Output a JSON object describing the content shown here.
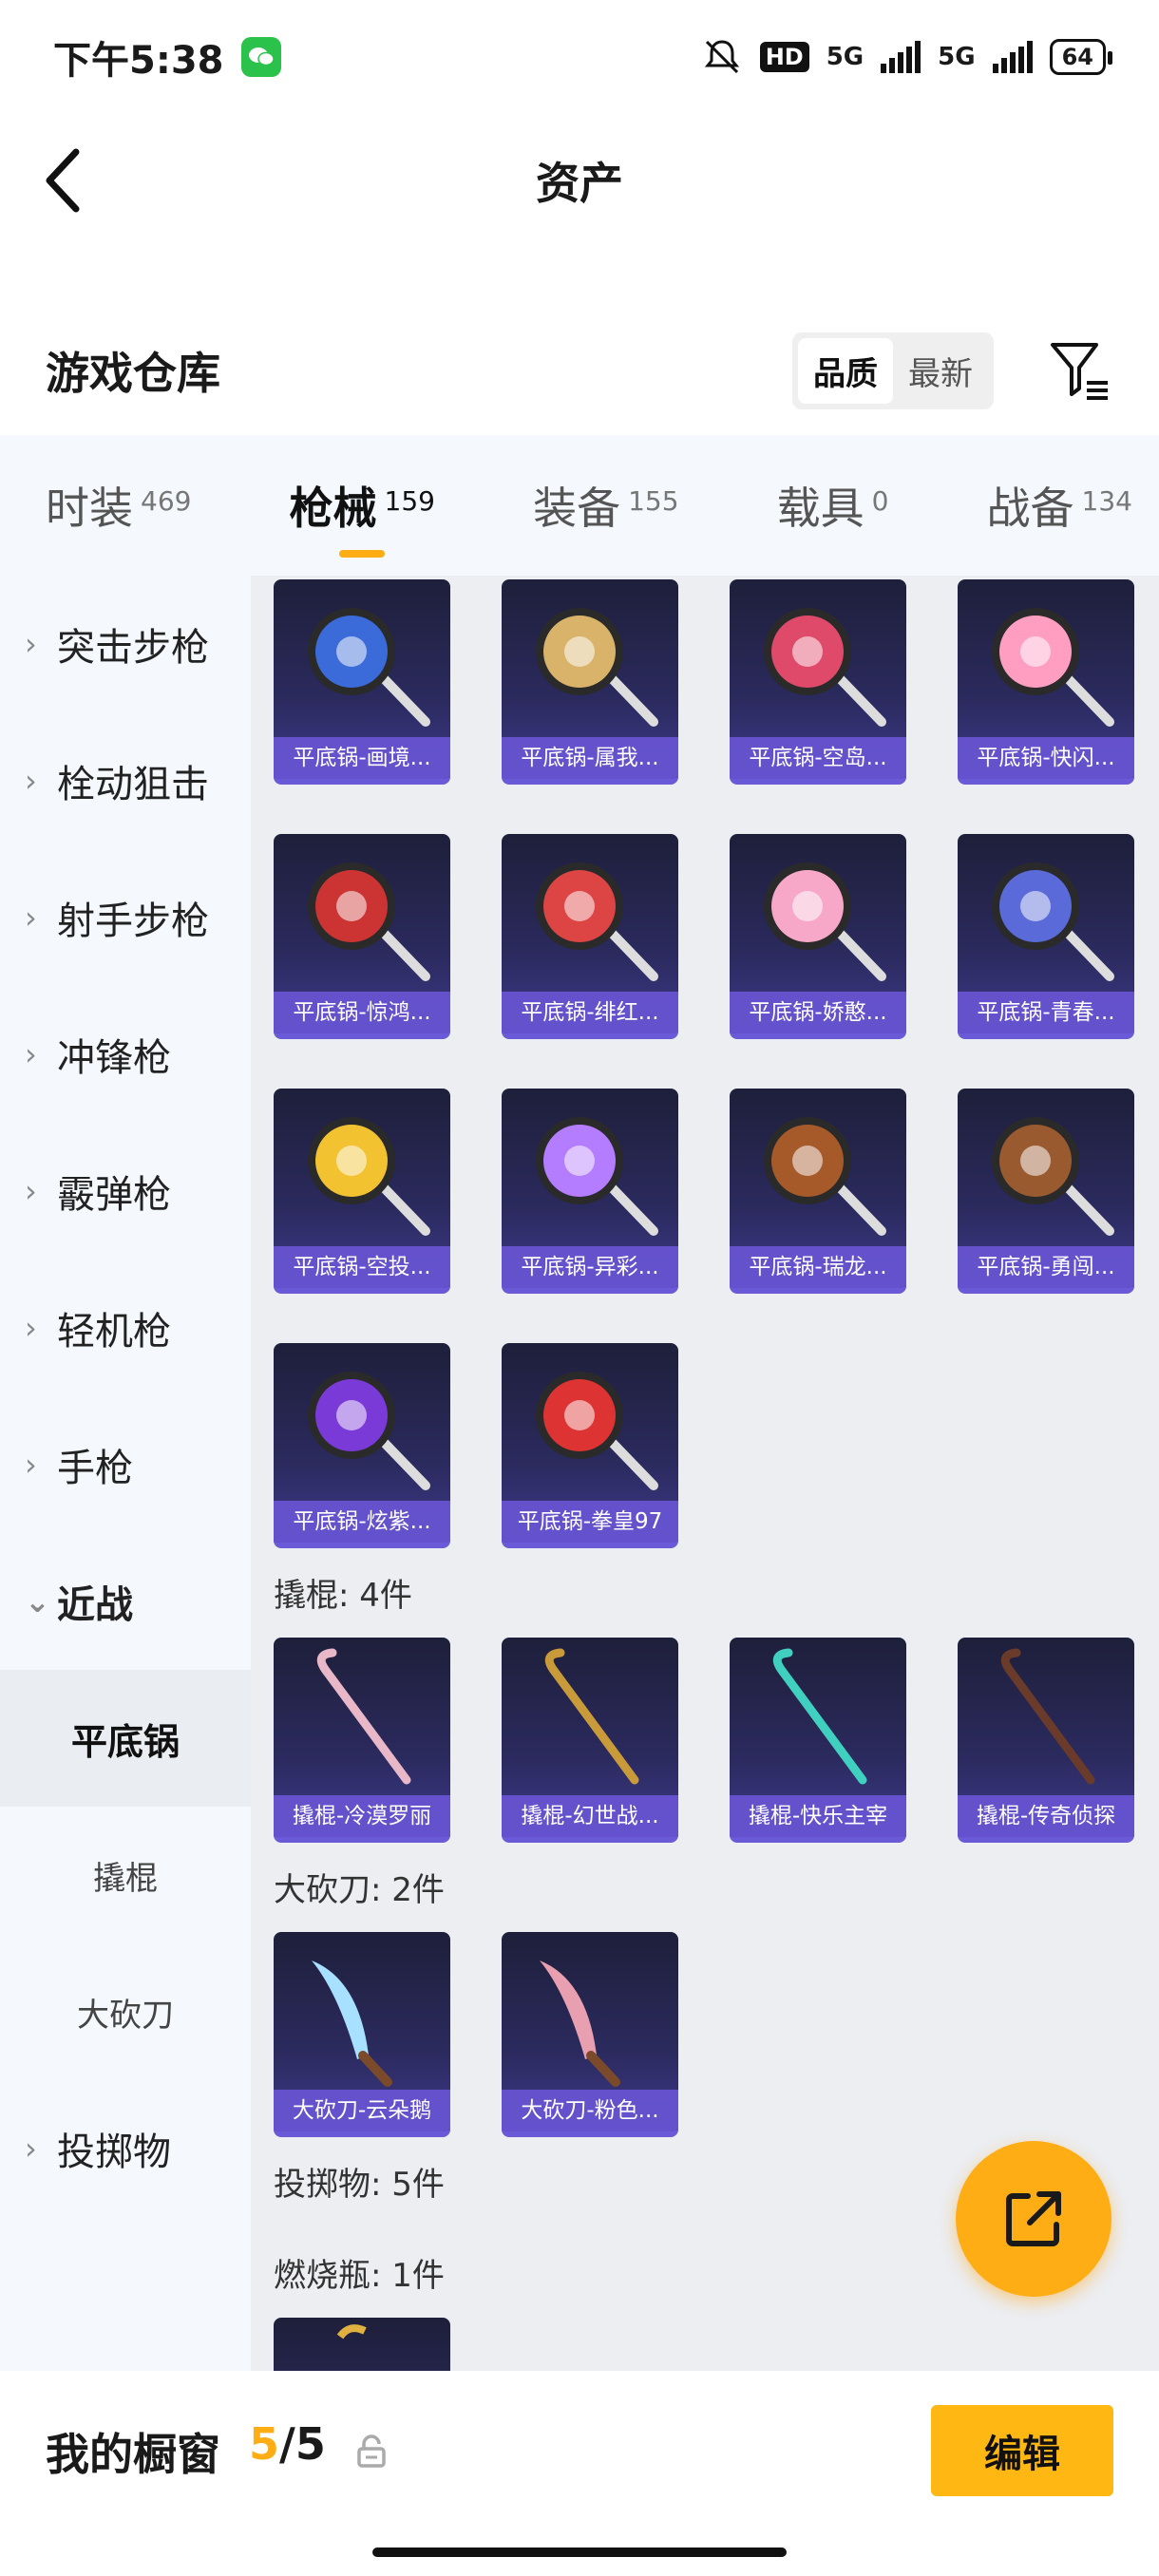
{
  "status_bar": {
    "time": "下午5:38",
    "hd_badge": "HD",
    "net1": "5G",
    "net2": "5G",
    "battery": "64"
  },
  "header": {
    "title": "资产"
  },
  "warehouse": {
    "title": "游戏仓库",
    "sort_options": [
      "品质",
      "最新"
    ],
    "sort_selected": "品质"
  },
  "tabs": [
    {
      "label": "时装",
      "count": "469"
    },
    {
      "label": "枪械",
      "count": "159",
      "active": true
    },
    {
      "label": "装备",
      "count": "155"
    },
    {
      "label": "载具",
      "count": "0"
    },
    {
      "label": "战备",
      "count": "134"
    }
  ],
  "sidebar": {
    "categories": [
      "突击步枪",
      "栓动狙击",
      "射手步枪",
      "冲锋枪",
      "霰弹枪",
      "轻机枪",
      "手枪"
    ],
    "open_category": "近战",
    "sub_items": [
      "平底锅",
      "撬棍",
      "大砍刀"
    ],
    "sub_selected": "平底锅",
    "last_category": "投掷物"
  },
  "content": {
    "pans": [
      "平底锅-画境...",
      "平底锅-属我...",
      "平底锅-空岛...",
      "平底锅-快闪...",
      "平底锅-惊鸿...",
      "平底锅-绯红...",
      "平底锅-娇憨...",
      "平底锅-青春...",
      "平底锅-空投...",
      "平底锅-异彩...",
      "平底锅-瑞龙...",
      "平底锅-勇闯...",
      "平底锅-炫紫...",
      "平底锅-拳皇97"
    ],
    "crowbar_heading": "撬棍: 4件",
    "crowbars": [
      "撬棍-冷漠罗丽",
      "撬棍-幻世战...",
      "撬棍-快乐主宰",
      "撬棍-传奇侦探"
    ],
    "machete_heading": "大砍刀: 2件",
    "machetes": [
      "大砍刀-云朵鹅",
      "大砍刀-粉色..."
    ],
    "throwable_heading": "投掷物: 5件",
    "molotov_heading": "燃烧瓶: 1件"
  },
  "bottom_bar": {
    "title": "我的橱窗",
    "count_current": "5",
    "count_sep": "/",
    "count_total": "5",
    "edit_label": "编辑"
  },
  "colors": {
    "accent": "#ffad14",
    "card_bg": "#2b2a5e",
    "card_label": "#6854d2"
  }
}
